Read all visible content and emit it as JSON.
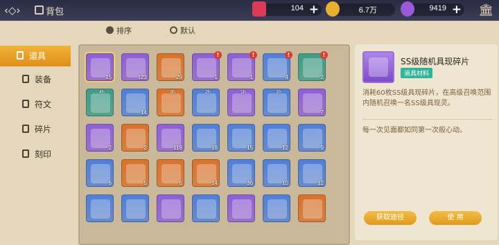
{
  "header": {
    "title": "背包"
  },
  "resources": [
    {
      "name": "ticket",
      "value": "104",
      "color": "#d93b58"
    },
    {
      "name": "gold",
      "value": "6.7万",
      "color": "#e8b02f"
    },
    {
      "name": "gem",
      "value": "9419",
      "color": "#9a5ad8"
    }
  ],
  "sort": {
    "order_label": "排序",
    "mode_label": "默认"
  },
  "sidebar": {
    "items": [
      {
        "label": "道具",
        "active": true
      },
      {
        "label": "装备",
        "active": false
      },
      {
        "label": "符文",
        "active": false
      },
      {
        "label": "碎片",
        "active": false
      },
      {
        "label": "刻印",
        "active": false
      }
    ]
  },
  "inventory": [
    {
      "color": "#8f5fd6",
      "count": "15",
      "selected": true
    },
    {
      "color": "#8f5fd6",
      "count": "123"
    },
    {
      "color": "#d9722b",
      "count": "29"
    },
    {
      "color": "#8f5fd6",
      "count": "1",
      "badge": "!"
    },
    {
      "color": "#8f5fd6",
      "count": "1",
      "badge": "!"
    },
    {
      "color": "#4f7fd8",
      "count": "4",
      "badge": "!"
    },
    {
      "color": "#3d9c88",
      "count": "2",
      "badge": "!"
    },
    {
      "color": "#3d9c88",
      "count": "",
      "timer": "4h"
    },
    {
      "color": "#4f7fd8",
      "count": "14"
    },
    {
      "color": "#d9722b",
      "count": "",
      "timer": "3h"
    },
    {
      "color": "#4f7fd8",
      "count": "",
      "timer": "2h"
    },
    {
      "color": "#8f5fd6",
      "count": "",
      "timer": "1h"
    },
    {
      "color": "#4f7fd8",
      "count": "",
      "timer": "1h"
    },
    {
      "color": "#8f5fd6",
      "count": "7"
    },
    {
      "color": "#8f5fd6",
      "count": "2"
    },
    {
      "color": "#d9722b",
      "count": "2"
    },
    {
      "color": "#8f5fd6",
      "count": "118"
    },
    {
      "color": "#4f7fd8",
      "count": "18"
    },
    {
      "color": "#4f7fd8",
      "count": "15"
    },
    {
      "color": "#4f7fd8",
      "count": "12"
    },
    {
      "color": "#4f7fd8",
      "count": "9"
    },
    {
      "color": "#4f7fd8",
      "count": "6"
    },
    {
      "color": "#d9722b",
      "count": "5"
    },
    {
      "color": "#d9722b",
      "count": "6"
    },
    {
      "color": "#d9722b",
      "count": "14"
    },
    {
      "color": "#4f7fd8",
      "count": "36"
    },
    {
      "color": "#4f7fd8",
      "count": "10"
    },
    {
      "color": "#4f7fd8",
      "count": "12"
    },
    {
      "color": "#4f7fd8",
      "count": ""
    },
    {
      "color": "#4f7fd8",
      "count": ""
    },
    {
      "color": "#8f5fd6",
      "count": ""
    },
    {
      "color": "#4f7fd8",
      "count": ""
    },
    {
      "color": "#8f5fd6",
      "count": ""
    },
    {
      "color": "#4f7fd8",
      "count": ""
    },
    {
      "color": "#d9722b",
      "count": ""
    }
  ],
  "detail": {
    "name": "SS级随机具现碎片",
    "tag": "道具材料",
    "description": "消耗60枚SS级具现碎片，在高级召唤范围内随机召唤一名SS级具现灵。",
    "flavor": "每一次见面都如同第一次般心动。",
    "source_button": "获取途径",
    "use_button": "使  用"
  }
}
